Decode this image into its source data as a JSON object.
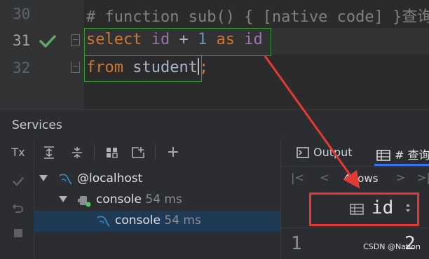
{
  "editor": {
    "lines": [
      {
        "number": "30",
        "comment": "# 查询字段为表达式"
      },
      {
        "number": "31",
        "tokens": [
          "select",
          "id",
          "+",
          "1",
          "as",
          "id"
        ]
      },
      {
        "number": "32",
        "tokens": [
          "from",
          "student",
          ";"
        ]
      }
    ]
  },
  "services": {
    "title": "Services",
    "tx_label": "Tx",
    "tree": [
      {
        "label": "@localhost",
        "time": ""
      },
      {
        "label": "console",
        "time": "54 ms"
      },
      {
        "label": "console",
        "time": "54 ms"
      }
    ]
  },
  "results": {
    "tabs": [
      {
        "label": "Output"
      },
      {
        "label": "# 查询"
      }
    ],
    "pager": {
      "rows_label": "4 rows"
    },
    "column": "id",
    "first_row": {
      "row_num": "1",
      "value": "2"
    }
  },
  "watermark": "CSDN @Nation",
  "colors": {
    "check": "#59a869",
    "highlight_box": "#2e9b2e",
    "callout": "#e53935",
    "accent": "#3574f0"
  },
  "icons": [
    "check-icon",
    "fold-icon",
    "expand-all-icon",
    "collapse-all-icon",
    "group-icon",
    "add-view-icon",
    "add-icon",
    "rollback-icon",
    "stop-icon",
    "output-icon",
    "table-icon",
    "database-icon",
    "console-icon",
    "first-page-icon",
    "prev-page-icon",
    "next-page-icon",
    "last-page-icon",
    "sort-icon"
  ]
}
